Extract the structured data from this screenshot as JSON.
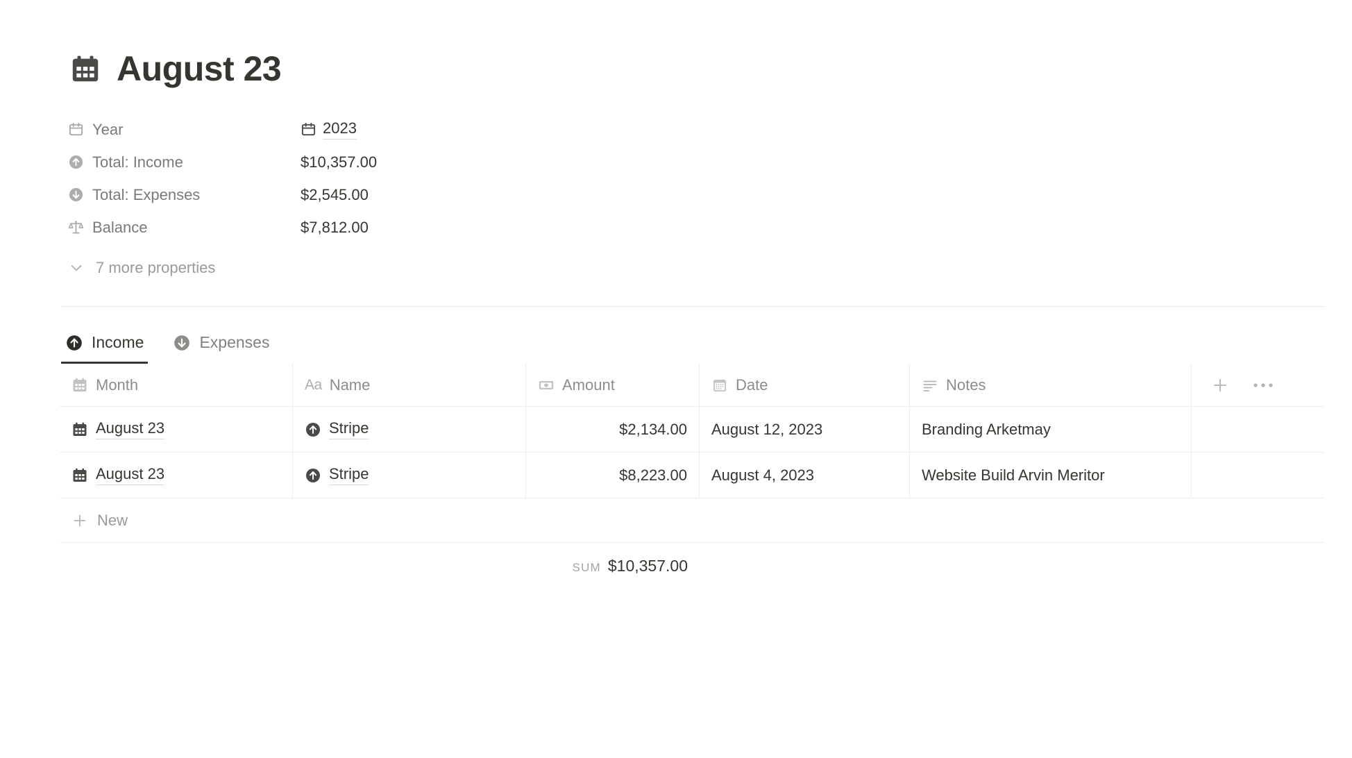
{
  "header": {
    "title": "August 23",
    "icon": "calendar-table-icon"
  },
  "properties": [
    {
      "icon": "calendar-icon",
      "label": "Year",
      "value": "2023",
      "type": "relation"
    },
    {
      "icon": "arrow-up-circle-icon",
      "label": "Total: Income",
      "value": "$10,357.00",
      "type": "text"
    },
    {
      "icon": "arrow-down-circle-icon",
      "label": "Total: Expenses",
      "value": "$2,545.00",
      "type": "text"
    },
    {
      "icon": "scales-icon",
      "label": "Balance",
      "value": "$7,812.00",
      "type": "text"
    }
  ],
  "more_properties": {
    "label": "7 more properties",
    "icon": "chevron-down-icon"
  },
  "tabs": [
    {
      "label": "Income",
      "icon": "arrow-up-circle-icon",
      "active": true
    },
    {
      "label": "Expenses",
      "icon": "arrow-down-circle-icon",
      "active": false
    }
  ],
  "table": {
    "columns": [
      {
        "label": "Month",
        "icon": "calendar-table-icon"
      },
      {
        "label": "Name",
        "icon": "aa-text-icon"
      },
      {
        "label": "Amount",
        "icon": "banknote-icon"
      },
      {
        "label": "Date",
        "icon": "calendar-date-icon"
      },
      {
        "label": "Notes",
        "icon": "text-lines-icon"
      }
    ],
    "add_column_icon": "plus-icon",
    "more_options_icon": "ellipsis-icon",
    "rows": [
      {
        "month": "August 23",
        "name": "Stripe",
        "amount": "$2,134.00",
        "date": "August 12, 2023",
        "notes": "Branding Arketmay"
      },
      {
        "month": "August 23",
        "name": "Stripe",
        "amount": "$8,223.00",
        "date": "August 4, 2023",
        "notes": "Website Build Arvin Meritor"
      }
    ],
    "new_row": {
      "label": "New",
      "icon": "plus-icon"
    },
    "footer": {
      "label": "SUM",
      "value": "$10,357.00"
    }
  },
  "colors": {
    "text": "#37352f",
    "muted": "#9b9a97",
    "border": "#edecea",
    "icon_gray": "#aeadaa",
    "icon_dark": "#4b4a47"
  }
}
